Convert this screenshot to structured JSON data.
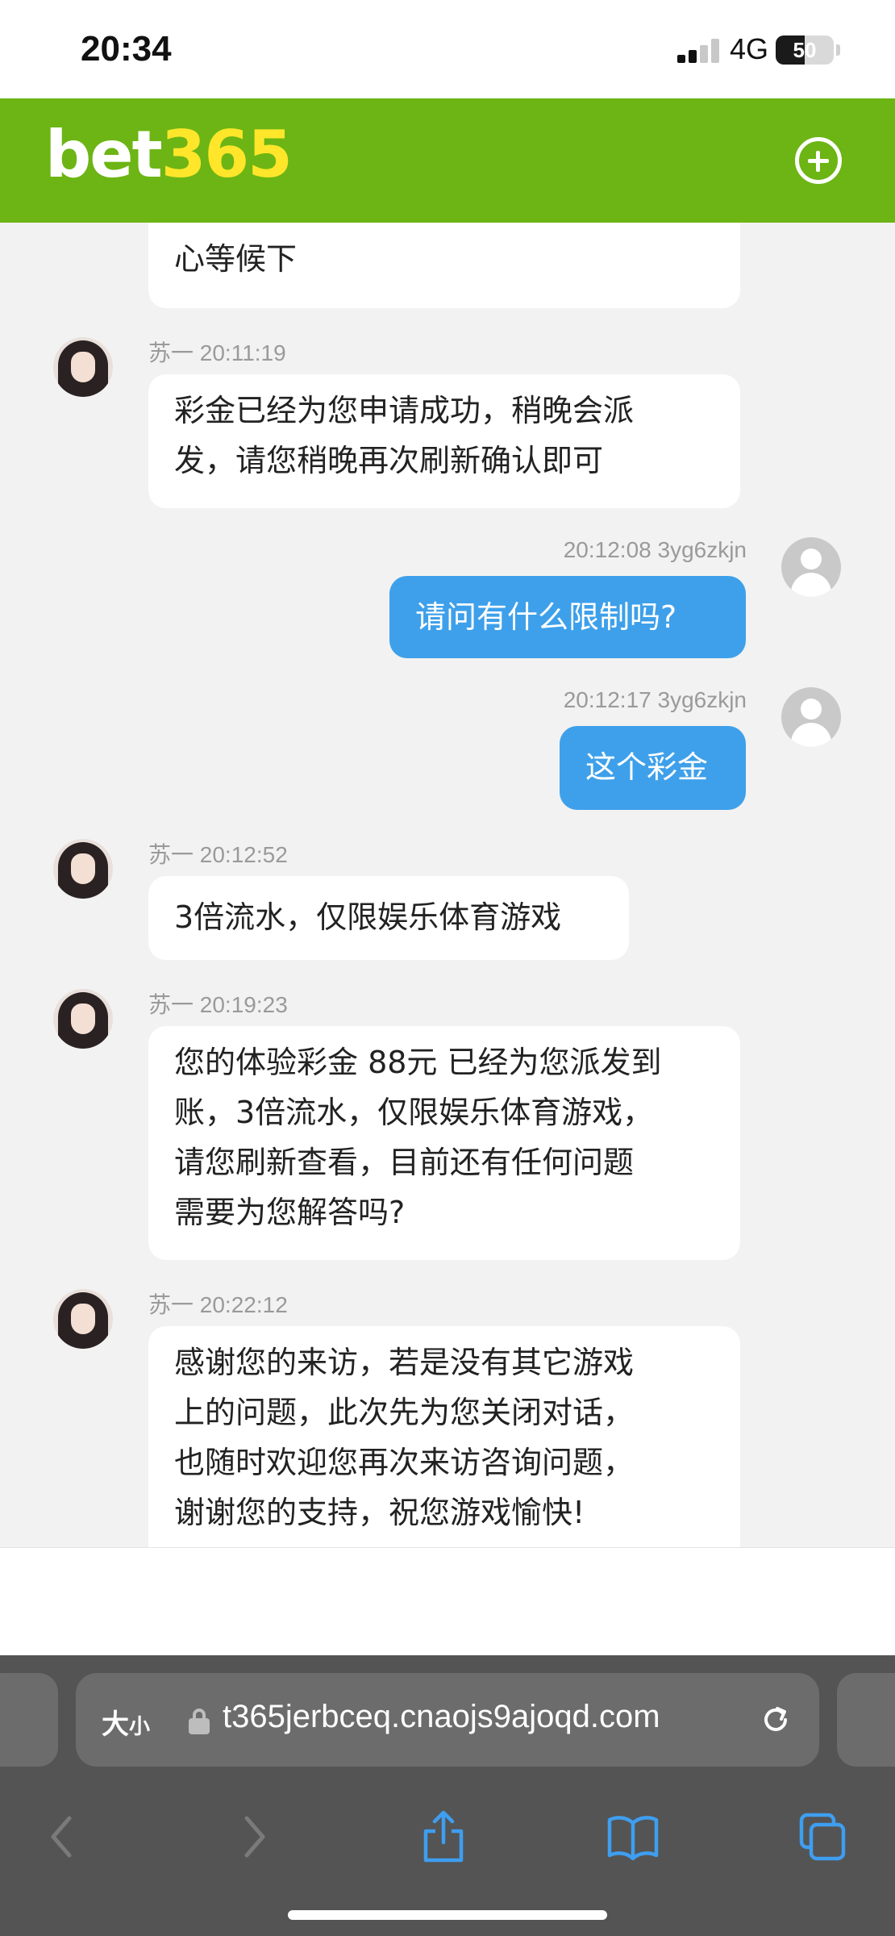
{
  "status_bar": {
    "time": "20:34",
    "network": "4G",
    "battery_level": 50,
    "battery_label": "50"
  },
  "header": {
    "logo_part1": "bet",
    "logo_part2": "365",
    "add_icon": "plus-circle-icon",
    "brand_color": "#6cb514",
    "logo_accent": "#ffe62a"
  },
  "chat": {
    "partial_message": "心等候下",
    "messages": [
      {
        "side": "left",
        "sender": "苏一",
        "time": "20:11:19",
        "meta": "苏一 20:11:19",
        "lines": [
          "彩金已经为您申请成功，稍晚会派",
          "发，请您稍晚再次刷新确认即可"
        ]
      },
      {
        "side": "right",
        "sender": "3yg6zkjn",
        "time": "20:12:08",
        "meta": "20:12:08 3yg6zkjn",
        "lines": [
          "请问有什么限制吗?"
        ]
      },
      {
        "side": "right",
        "sender": "3yg6zkjn",
        "time": "20:12:17",
        "meta": "20:12:17 3yg6zkjn",
        "lines": [
          "这个彩金"
        ]
      },
      {
        "side": "left",
        "sender": "苏一",
        "time": "20:12:52",
        "meta": "苏一 20:12:52",
        "lines": [
          "3倍流水，仅限娱乐体育游戏"
        ]
      },
      {
        "side": "left",
        "sender": "苏一",
        "time": "20:19:23",
        "meta": "苏一 20:19:23",
        "lines": [
          "您的体验彩金 88元 已经为您派发到",
          "账，3倍流水，仅限娱乐体育游戏，",
          "请您刷新查看，目前还有任何问题",
          "需要为您解答吗?"
        ]
      },
      {
        "side": "left",
        "sender": "苏一",
        "time": "20:22:12",
        "meta": "苏一 20:22:12",
        "lines": [
          "感谢您的来访，若是没有其它游戏",
          "上的问题，此次先为您关闭对话，",
          "也随时欢迎您再次来访咨询问题，",
          "谢谢您的支持，祝您游戏愉快!"
        ]
      }
    ],
    "agent_bubble_color": "#ffffff",
    "user_bubble_color": "#3ea0ea"
  },
  "browser": {
    "text_size_big": "大",
    "text_size_small": "小",
    "url": "t365jerbceq.cnaojs9ajoqd.com",
    "icons": [
      "lock-icon",
      "reload-icon",
      "back-icon",
      "forward-icon",
      "share-icon",
      "bookmarks-icon",
      "tabs-icon"
    ]
  }
}
